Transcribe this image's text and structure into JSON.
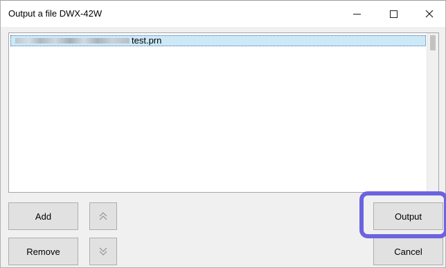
{
  "window": {
    "title": "Output a file DWX-42W",
    "minimize_icon": "minimize-icon",
    "maximize_icon": "maximize-icon",
    "close_icon": "close-icon",
    "close_glyph": "✕"
  },
  "file_list": {
    "items": [
      {
        "label": "test.prn",
        "selected": true
      }
    ]
  },
  "buttons": {
    "add": "Add",
    "remove": "Remove",
    "move_up_icon": "double-chevron-up-icon",
    "move_up_glyph": "︽",
    "move_down_icon": "double-chevron-down-icon",
    "move_down_glyph": "︾",
    "output": "Output",
    "cancel": "Cancel"
  },
  "colors": {
    "highlight": "#6b63e0",
    "selection": "#cde8f7"
  }
}
